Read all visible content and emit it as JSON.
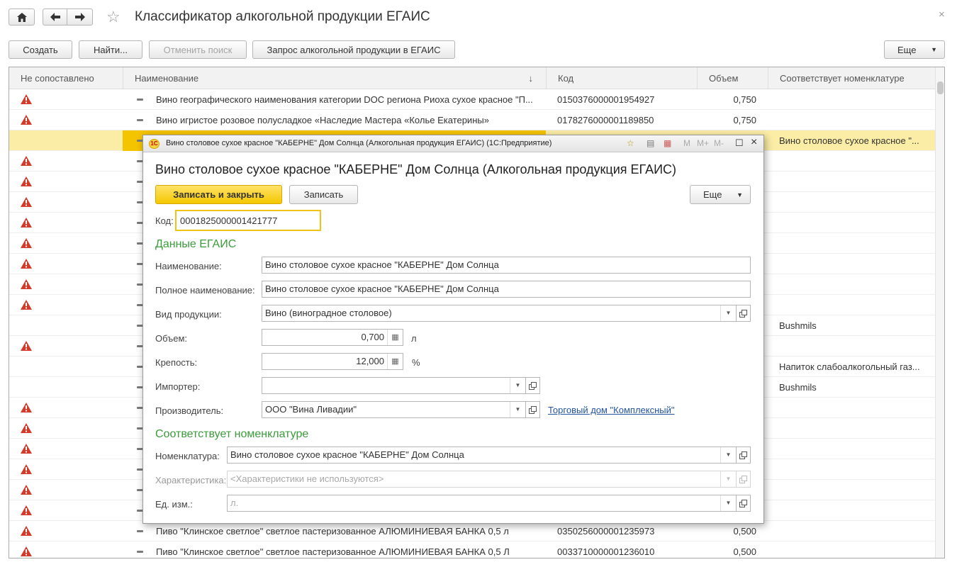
{
  "window": {
    "title": "Классификатор алкогольной продукции ЕГАИС",
    "close_glyph": "×"
  },
  "toolbar": {
    "create": "Создать",
    "find": "Найти...",
    "cancel_search": "Отменить поиск",
    "request": "Запрос алкогольной продукции в ЕГАИС",
    "more": "Еще"
  },
  "list": {
    "columns": [
      "Не сопоставлено",
      "Наименование",
      "Код",
      "Объем",
      "Соответствует номенклатуре"
    ],
    "sort_glyph": "↓",
    "rows": [
      {
        "warn": true,
        "name": "Вино географического наименования категории DOC региона Риоха сухое красное \"П...",
        "code": "0150376000001954927",
        "volume": "0,750",
        "nom": "",
        "sel": false
      },
      {
        "warn": true,
        "name": "Вино игристое розовое полусладкое «Наследие Мастера «Колье Екатерины»",
        "code": "0178276000001189850",
        "volume": "0,750",
        "nom": "",
        "sel": false
      },
      {
        "warn": false,
        "name": "",
        "code": "",
        "volume": "",
        "nom": "Вино столовое сухое красное \"...",
        "sel": true
      },
      {
        "warn": true,
        "name": "",
        "code": "",
        "volume": "",
        "nom": "",
        "sel": false
      },
      {
        "warn": true,
        "name": "",
        "code": "",
        "volume": "",
        "nom": "",
        "sel": false
      },
      {
        "warn": true,
        "name": "",
        "code": "",
        "volume": "",
        "nom": "",
        "sel": false
      },
      {
        "warn": true,
        "name": "",
        "code": "",
        "volume": "",
        "nom": "",
        "sel": false
      },
      {
        "warn": true,
        "name": "",
        "code": "",
        "volume": "",
        "nom": "",
        "sel": false
      },
      {
        "warn": true,
        "name": "",
        "code": "",
        "volume": "",
        "nom": "",
        "sel": false
      },
      {
        "warn": true,
        "name": "",
        "code": "",
        "volume": "",
        "nom": "",
        "sel": false
      },
      {
        "warn": true,
        "name": "",
        "code": "",
        "volume": "",
        "nom": "",
        "sel": false
      },
      {
        "warn": false,
        "name": "",
        "code": "",
        "volume": "",
        "nom": "Bushmils",
        "sel": false
      },
      {
        "warn": true,
        "name": "",
        "code": "",
        "volume": "",
        "nom": "",
        "sel": false
      },
      {
        "warn": false,
        "name": "",
        "code": "",
        "volume": "",
        "nom": "Напиток слабоалкогольный газ...",
        "sel": false
      },
      {
        "warn": false,
        "name": "",
        "code": "",
        "volume": "",
        "nom": "Bushmils",
        "sel": false
      },
      {
        "warn": true,
        "name": "",
        "code": "",
        "volume": "",
        "nom": "",
        "sel": false
      },
      {
        "warn": true,
        "name": "",
        "code": "",
        "volume": "",
        "nom": "",
        "sel": false
      },
      {
        "warn": true,
        "name": "",
        "code": "",
        "volume": "",
        "nom": "",
        "sel": false
      },
      {
        "warn": true,
        "name": "",
        "code": "",
        "volume": "",
        "nom": "",
        "sel": false
      },
      {
        "warn": true,
        "name": "",
        "code": "",
        "volume": "",
        "nom": "",
        "sel": false
      },
      {
        "warn": true,
        "name": "",
        "code": "",
        "volume": "",
        "nom": "",
        "sel": false
      },
      {
        "warn": true,
        "name": "Пиво \"Клинское светлое\" светлое пастеризованное АЛЮМИНИЕВАЯ БАНКА 0,5 л",
        "code": "0350256000001235973",
        "volume": "0,500",
        "nom": "",
        "sel": false
      },
      {
        "warn": true,
        "name": "Пиво \"Клинское светлое\" светлое пастеризованное АЛЮМИНИЕВАЯ БАНКА 0,5 Л",
        "code": "0033710000001236010",
        "volume": "0,500",
        "nom": "",
        "sel": false
      }
    ]
  },
  "dialog": {
    "caption": "Вино столовое сухое красное \"КАБЕРНЕ\" Дом Солнца (Алкогольная продукция ЕГАИС)  (1С:Предприятие)",
    "logo": "1С",
    "caption_icons": {
      "m": "M",
      "mplus": "M+",
      "mminus": "M-"
    },
    "title": "Вино столовое сухое красное \"КАБЕРНЕ\" Дом Солнца (Алкогольная продукция ЕГАИС)",
    "save_close": "Записать и закрыть",
    "save": "Записать",
    "more": "Еще",
    "code_label": "Код:",
    "code_value": "0001825000001421777",
    "section_egais": "Данные ЕГАИС",
    "name_label": "Наименование:",
    "name_value": "Вино столовое сухое красное \"КАБЕРНЕ\" Дом Солнца",
    "fullname_label": "Полное наименование:",
    "fullname_value": "Вино столовое сухое красное \"КАБЕРНЕ\" Дом Солнца",
    "kind_label": "Вид продукции:",
    "kind_value": "Вино (виноградное столовое)",
    "volume_label": "Объем:",
    "volume_value": "0,700",
    "volume_unit": "л",
    "strength_label": "Крепость:",
    "strength_value": "12,000",
    "strength_unit": "%",
    "importer_label": "Импортер:",
    "importer_value": "",
    "producer_label": "Производитель:",
    "producer_value": "ООО \"Вина Ливадии\"",
    "producer_link": "Торговый дом \"Комплексный\"",
    "section_nom": "Соответствует номенклатуре",
    "nom_label": "Номенклатура:",
    "nom_value": "Вино столовое сухое красное \"КАБЕРНЕ\" Дом Солнца",
    "char_label": "Характеристика:",
    "char_placeholder": "<Характеристики не используются>",
    "unit_label": "Ед. изм.:",
    "unit_value": "л."
  },
  "colors": {
    "accent_yellow": "#f4c700",
    "selection": "#fbeda5",
    "section_green": "#3a9c3a",
    "link": "#2254a0",
    "warning": "#d23a2a"
  }
}
